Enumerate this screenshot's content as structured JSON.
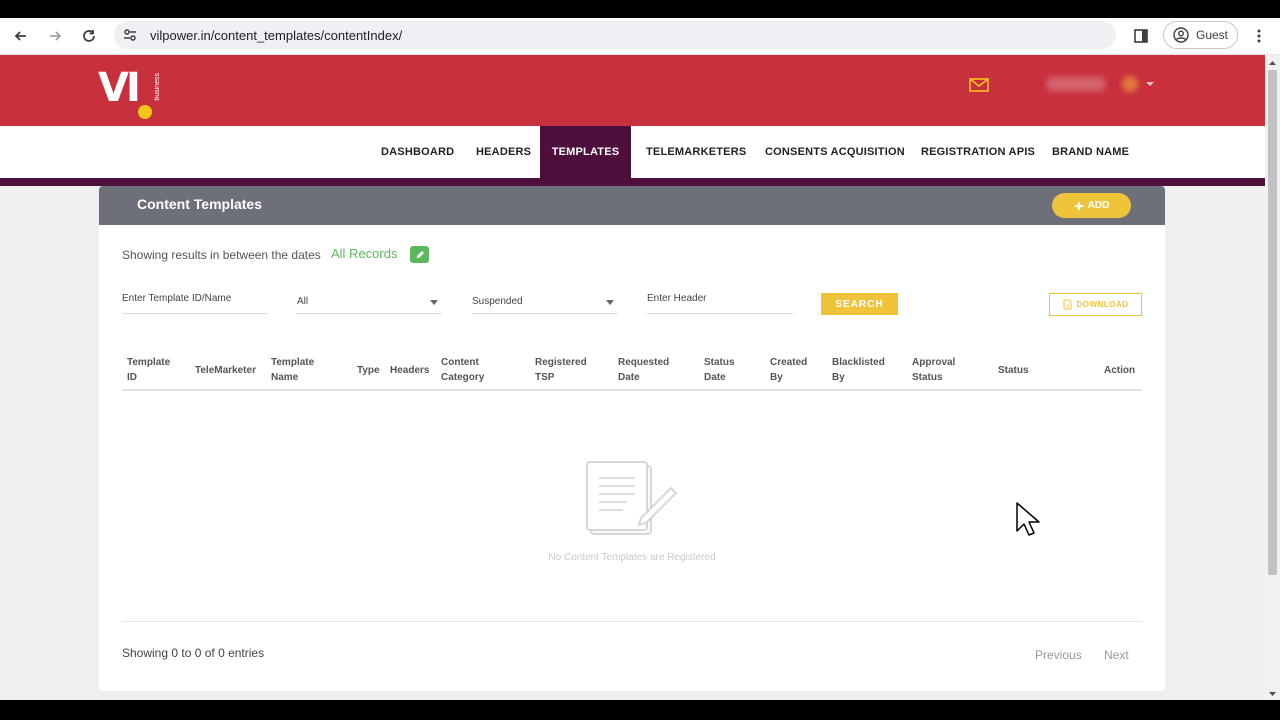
{
  "browser": {
    "url": "vilpower.in/content_templates/contentIndex/",
    "profile_label": "Guest"
  },
  "brand": {
    "logo_text": "VI",
    "logo_subtext": "business",
    "colors": {
      "brand_red": "#c8303e",
      "nav_active": "#4f0f3c",
      "accent_yellow": "#f0c43a",
      "green": "#5cb85c"
    }
  },
  "nav": {
    "items": [
      {
        "label": "DASHBOARD"
      },
      {
        "label": "HEADERS"
      },
      {
        "label": "TEMPLATES"
      },
      {
        "label": "TELEMARKETERS"
      },
      {
        "label": "CONSENTS ACQUISITION"
      },
      {
        "label": "REGISTRATION APIS"
      },
      {
        "label": "BRAND NAME"
      }
    ],
    "active": "TEMPLATES"
  },
  "card": {
    "title": "Content Templates",
    "add_label": "ADD"
  },
  "filters": {
    "dates_text": "Showing results in between the dates",
    "date_range_value": "All Records",
    "template_id_placeholder": "Enter Template ID/Name",
    "type_value": "All",
    "status_value": "Suspended",
    "header_placeholder": "Enter Header",
    "search_label": "SEARCH",
    "download_label": "DOWNLOAD"
  },
  "table": {
    "columns": [
      {
        "l1": "Template",
        "l2": "ID"
      },
      {
        "l1": "TeleMarketer",
        "l2": ""
      },
      {
        "l1": "Template",
        "l2": "Name"
      },
      {
        "l1": "Type",
        "l2": ""
      },
      {
        "l1": "Headers",
        "l2": ""
      },
      {
        "l1": "Content",
        "l2": "Category"
      },
      {
        "l1": "Registered",
        "l2": "TSP"
      },
      {
        "l1": "Requested",
        "l2": "Date"
      },
      {
        "l1": "Status",
        "l2": "Date"
      },
      {
        "l1": "Created",
        "l2": "By"
      },
      {
        "l1": "Blacklisted",
        "l2": "By"
      },
      {
        "l1": "Approval",
        "l2": "Status"
      },
      {
        "l1": "Status",
        "l2": ""
      },
      {
        "l1": "Action",
        "l2": ""
      }
    ],
    "empty_message": "No Content Templates are Registered",
    "entries_text": "Showing 0 to 0 of 0 entries",
    "previous_label": "Previous",
    "next_label": "Next"
  }
}
